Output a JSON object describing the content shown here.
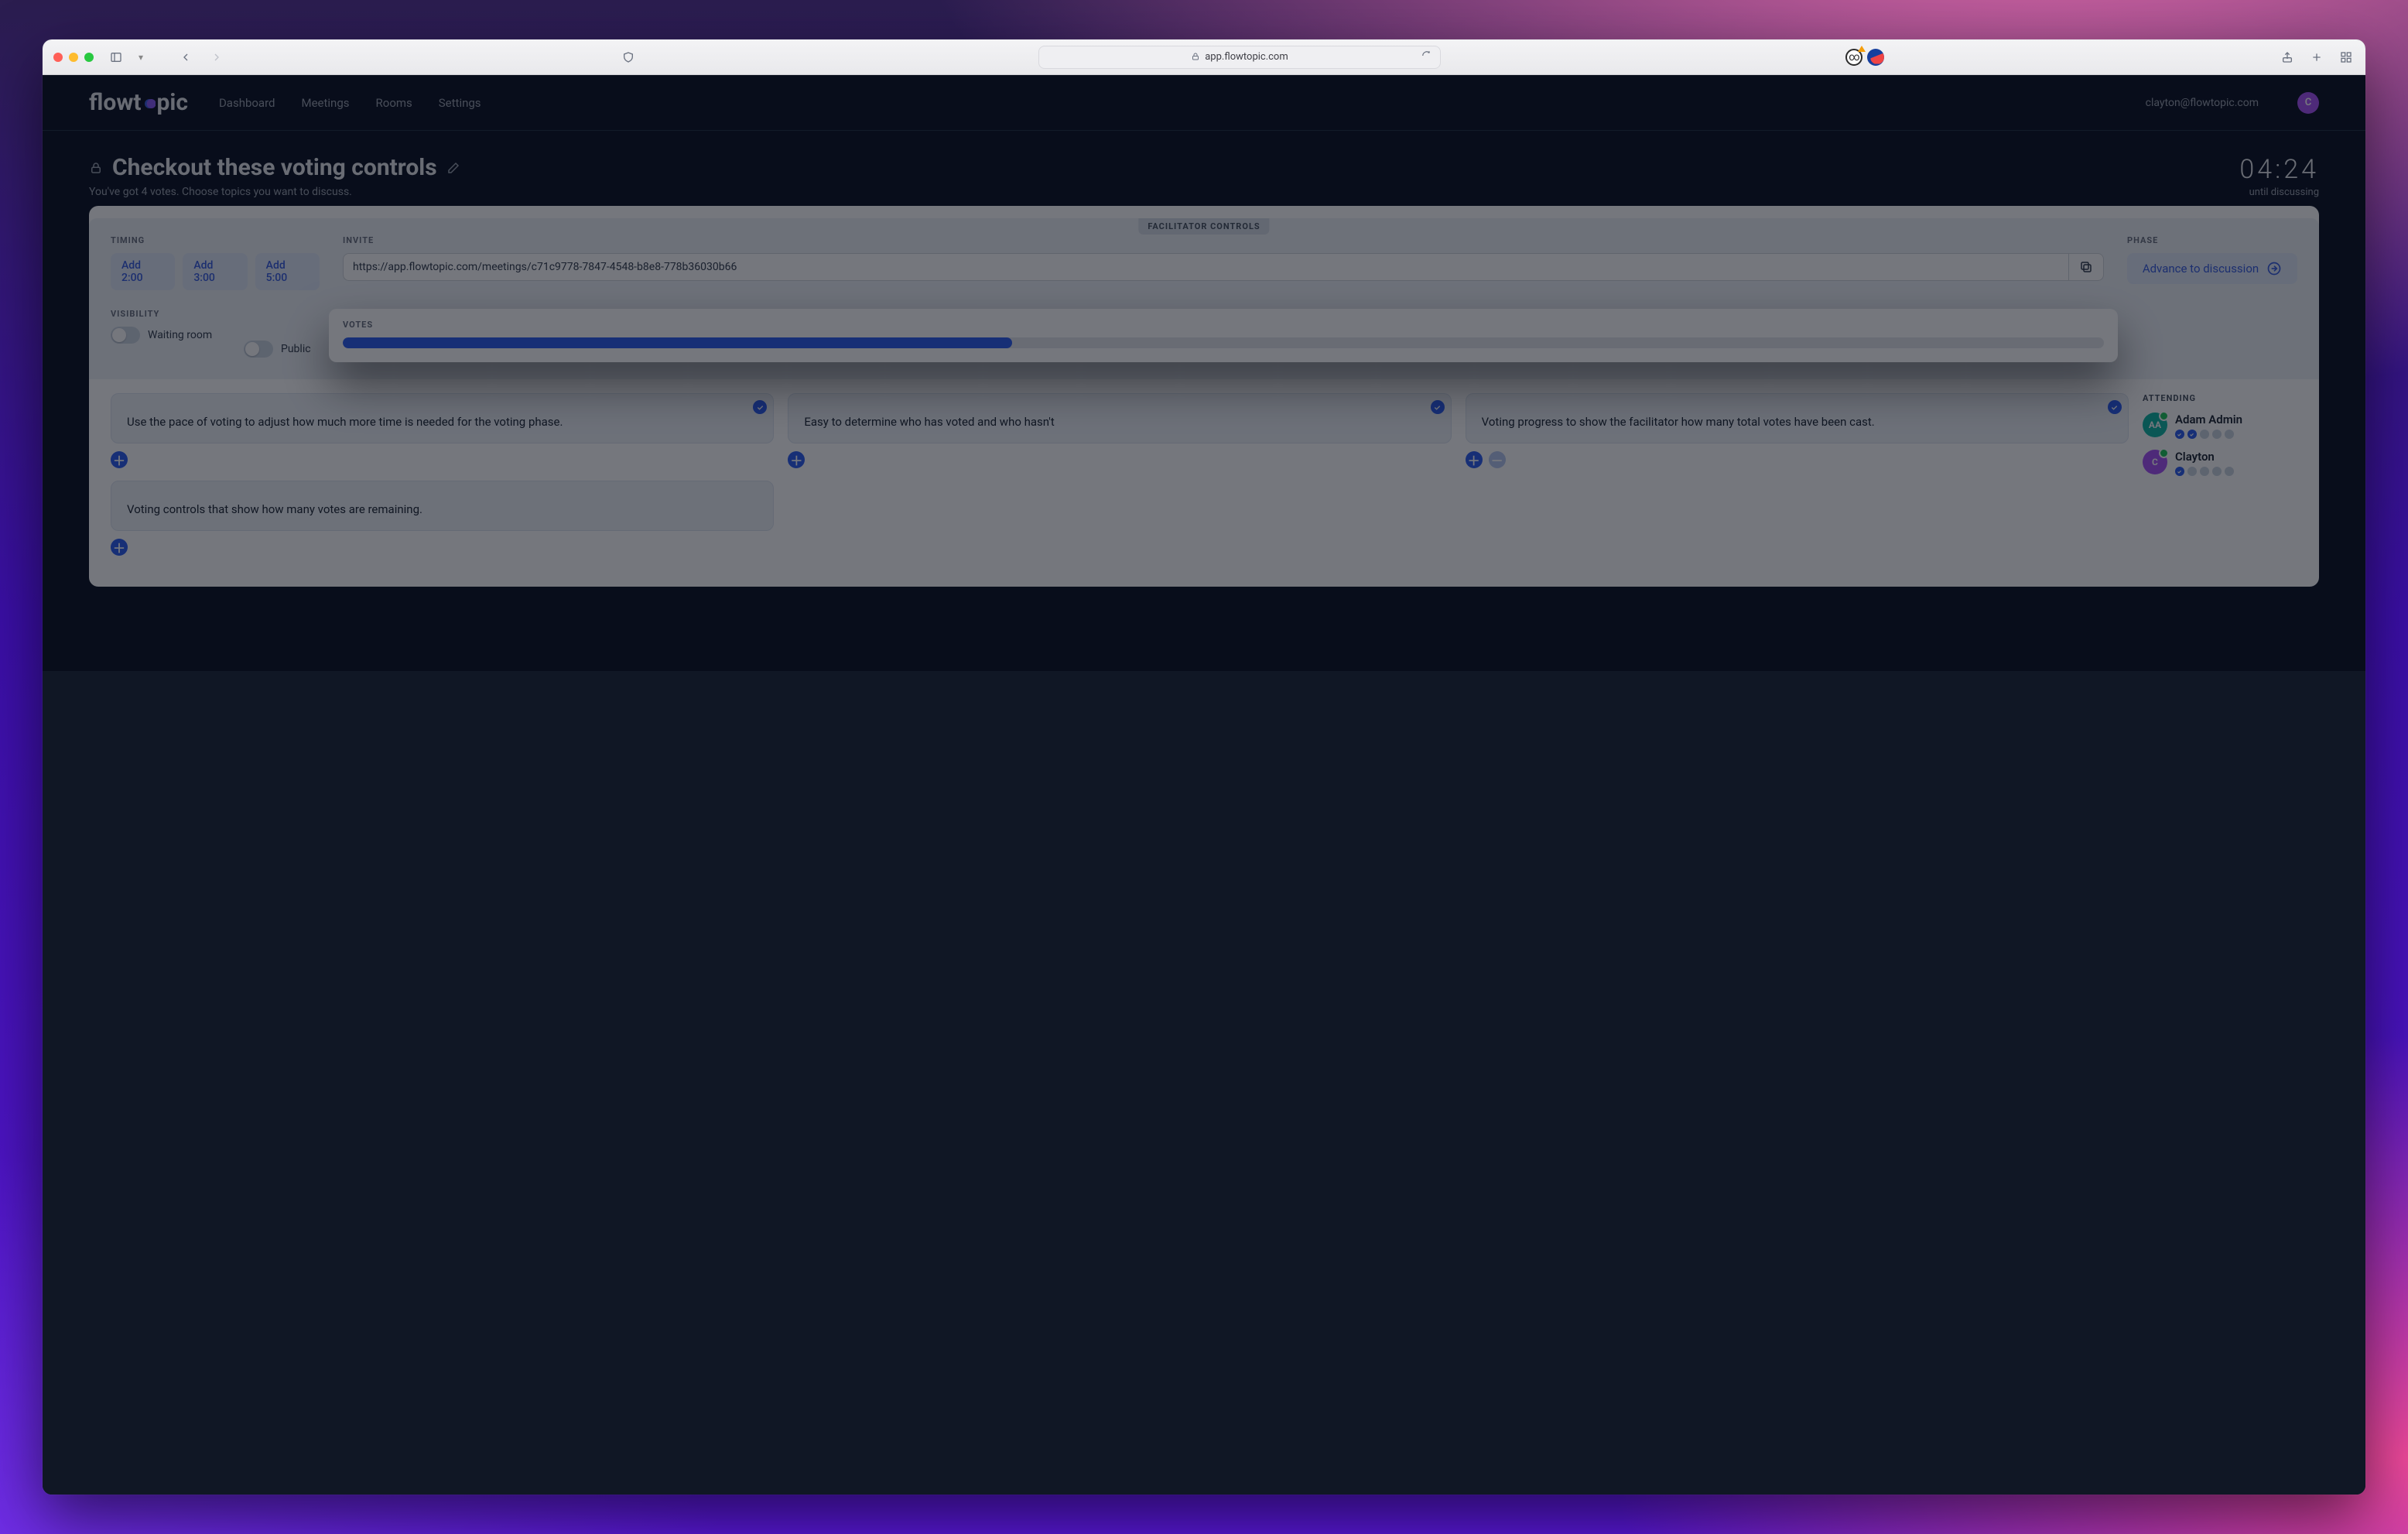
{
  "browser": {
    "address_display": "app.flowtopic.com"
  },
  "brand": {
    "pre": "flowt",
    "post": "pic"
  },
  "nav": [
    "Dashboard",
    "Meetings",
    "Rooms",
    "Settings"
  ],
  "user": {
    "email": "clayton@flowtopic.com",
    "initial": "C"
  },
  "heading": {
    "title": "Checkout these voting controls",
    "subtitle": "You've got 4 votes. Choose topics you want to discuss."
  },
  "timer": {
    "value": "04:24",
    "caption": "until discussing"
  },
  "facilitator": {
    "banner": "FACILITATOR CONTROLS",
    "timing_label": "TIMING",
    "timing_buttons": [
      "Add 2:00",
      "Add 3:00",
      "Add 5:00"
    ],
    "invite_label": "INVITE",
    "invite_url": "https://app.flowtopic.com/meetings/c71c9778-7847-4548-b8e8-778b36030b66",
    "phase_label": "PHASE",
    "advance_label": "Advance to discussion",
    "visibility_label": "VISIBILITY",
    "toggle_waiting": "Waiting room",
    "toggle_public": "Public",
    "votes_label": "VOTES",
    "votes_progress_pct": 38
  },
  "cards": {
    "c1": "Use the pace of voting to adjust how much more time is needed for the voting phase.",
    "c2": "Easy to determine who has voted and who hasn't",
    "c3": "Voting progress to show the facilitator how many total votes have been cast.",
    "c4": "Voting controls that show how many votes are remaining."
  },
  "attending": {
    "label": "ATTENDING",
    "a1": {
      "name": "Adam Admin",
      "initials": "AA",
      "votes_on": 2,
      "votes_total": 5
    },
    "a2": {
      "name": "Clayton",
      "initials": "C",
      "votes_on": 1,
      "votes_total": 5
    }
  }
}
